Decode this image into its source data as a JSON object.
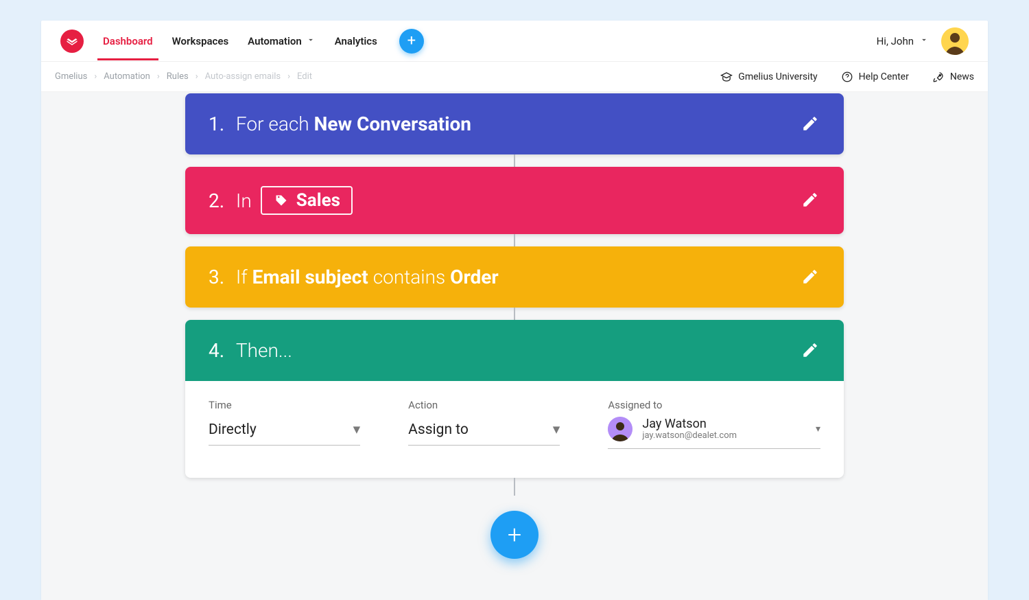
{
  "nav": {
    "dashboard": "Dashboard",
    "workspaces": "Workspaces",
    "automation": "Automation",
    "analytics": "Analytics"
  },
  "user": {
    "greeting": "Hi, John"
  },
  "breadcrumb": {
    "root": "Gmelius",
    "l1": "Automation",
    "l2": "Rules",
    "l3": "Auto-assign emails",
    "l4": "Edit"
  },
  "sublinks": {
    "university": "Gmelius University",
    "help": "Help Center",
    "news": "News"
  },
  "steps": {
    "trigger": {
      "num": "1.",
      "prefix": "For each",
      "value": "New Conversation"
    },
    "scope": {
      "num": "2.",
      "prefix": "In",
      "tag": "Sales"
    },
    "condition": {
      "num": "3.",
      "prefix": "If",
      "field": "Email subject",
      "operator": "contains",
      "value": "Order"
    },
    "then": {
      "num": "4.",
      "label": "Then..."
    }
  },
  "then_form": {
    "time_label": "Time",
    "time_value": "Directly",
    "action_label": "Action",
    "action_value": "Assign to",
    "assigned_label": "Assigned to",
    "assignee_name": "Jay Watson",
    "assignee_email": "jay.watson@dealet.com"
  }
}
